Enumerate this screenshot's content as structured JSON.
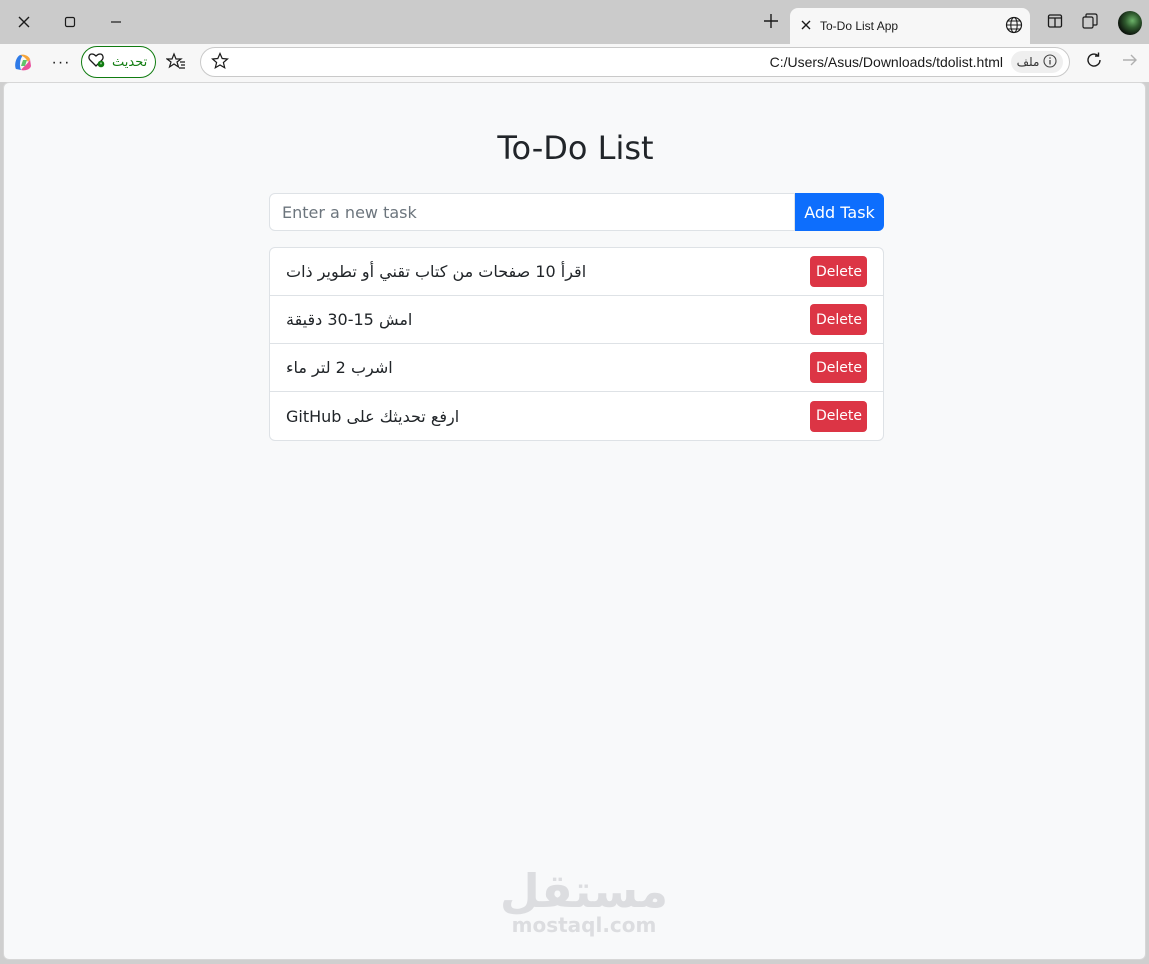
{
  "browser": {
    "tab": {
      "title": "To-Do List App"
    },
    "toolbar": {
      "update_label": "تحديث",
      "more_label": "···"
    },
    "address": {
      "url": "C:/Users/Asus/Downloads/tdolist.html",
      "file_chip": "ملف"
    },
    "icons": {
      "close": "close-icon",
      "maximize": "maximize-icon",
      "minimize": "minimize-icon",
      "new_tab": "plus-icon",
      "globe": "globe-icon",
      "split": "split-screen-icon",
      "collections": "collections-icon",
      "copilot": "copilot-icon",
      "favorites": "favorites-icon",
      "star": "star-icon",
      "reload": "reload-icon",
      "forward": "forward-arrow-icon",
      "info": "info-icon"
    },
    "colors": {
      "update_green": "#107c10"
    }
  },
  "page": {
    "title": "To-Do List",
    "input": {
      "placeholder": "Enter a new task",
      "value": ""
    },
    "add_button": "Add Task",
    "tasks": [
      {
        "text": "اقرأ 10 صفحات من كتاب تقني أو تطوير ذات",
        "delete_label": "Delete"
      },
      {
        "text": "امش 15-30 دقيقة",
        "delete_label": "Delete"
      },
      {
        "text": "اشرب 2 لتر ماء",
        "delete_label": "Delete"
      },
      {
        "text": "ارفع تحديثك على GitHub",
        "delete_label": "Delete"
      }
    ],
    "colors": {
      "primary": "#0d6efd",
      "danger": "#dc3545",
      "background": "#f8f9fa"
    },
    "watermark": {
      "arabic": "مستقل",
      "latin": "mostaql.com"
    }
  }
}
